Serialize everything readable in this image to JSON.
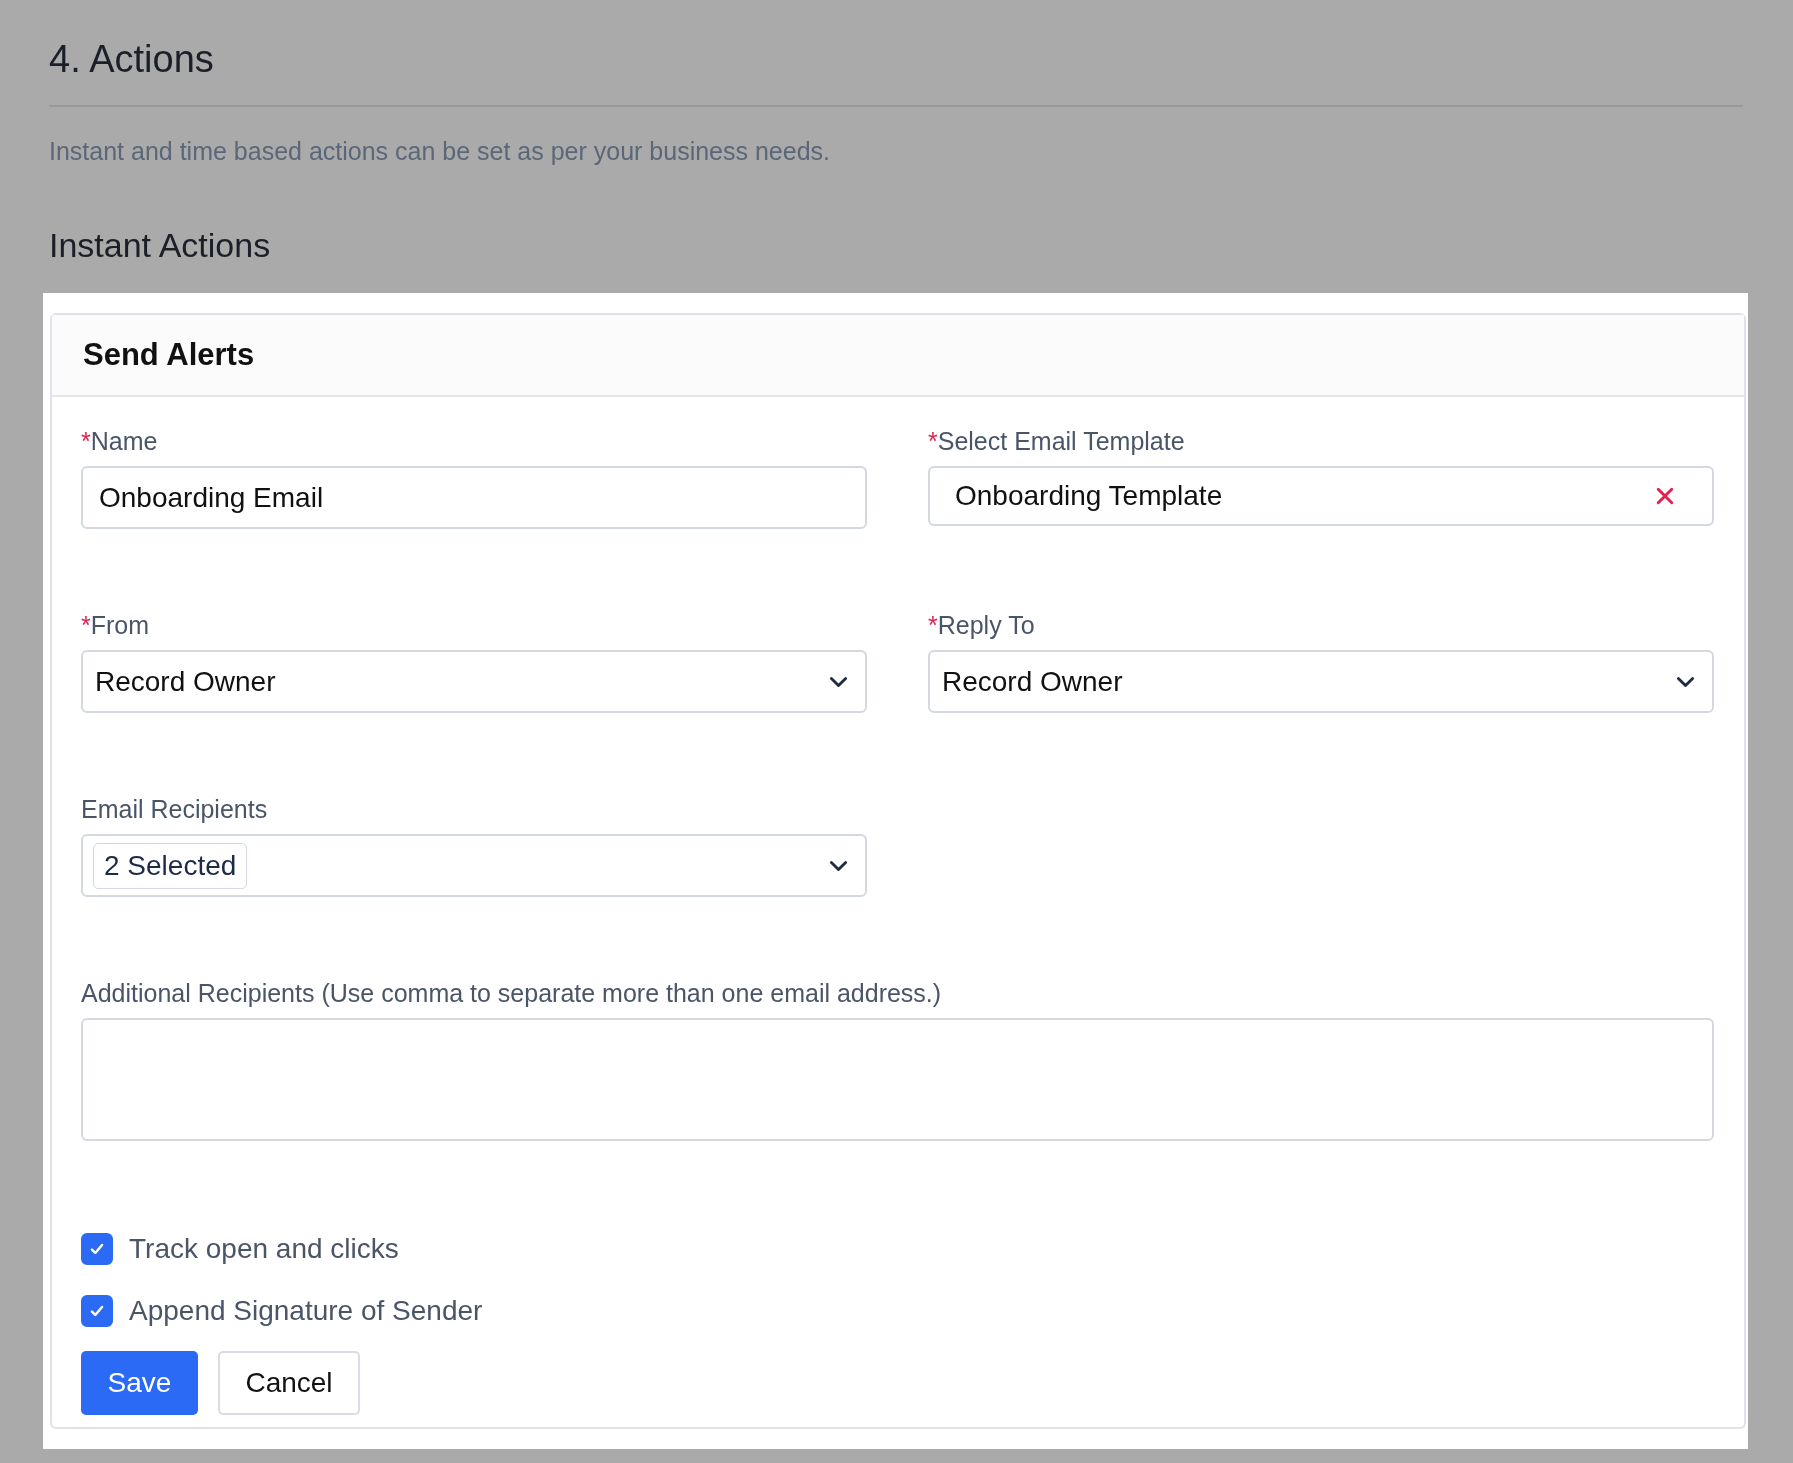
{
  "heading": "4. Actions",
  "description": "Instant and time based actions can be set as per your business needs.",
  "section_title": "Instant Actions",
  "card": {
    "title": "Send Alerts",
    "fields": [
      {
        "kind": "text",
        "required_mark": "*",
        "label": "Name",
        "value": "Onboarding Email"
      },
      {
        "kind": "clearable",
        "required_mark": "*",
        "label": "Select Email Template",
        "value": "Onboarding Template"
      },
      {
        "kind": "select",
        "required_mark": "*",
        "label": "From",
        "value": "Record Owner"
      },
      {
        "kind": "select",
        "required_mark": "*",
        "label": "Reply To",
        "value": "Record Owner"
      },
      {
        "kind": "multiselect",
        "label": "Email Recipients",
        "value": "2 Selected"
      },
      {
        "kind": "textarea",
        "label": "Additional Recipients (Use comma to separate more than one email address.)"
      }
    ],
    "checkboxes": [
      {
        "label": "Track open and clicks",
        "checked": true
      },
      {
        "label": "Append Signature of Sender",
        "checked": true
      }
    ],
    "buttons": [
      {
        "label": "Save",
        "kind": "primary"
      },
      {
        "label": "Cancel",
        "kind": "secondary"
      }
    ]
  }
}
